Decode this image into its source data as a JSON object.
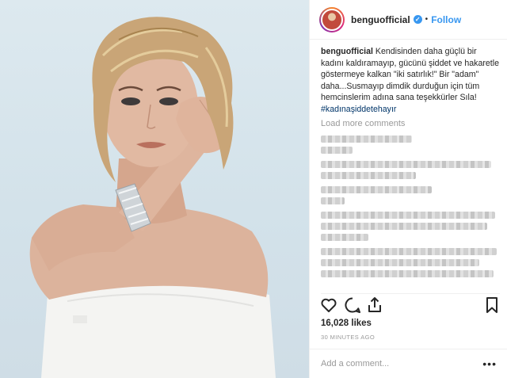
{
  "post": {
    "username": "benguofficial",
    "follow_label": "Follow",
    "dot": "•",
    "verified_glyph": "✓"
  },
  "caption": {
    "username": "benguofficial",
    "text": "Kendisinden daha güçlü bir kadını kaldıramayıp, gücünü şiddet ve hakaretle göstermeye kalkan \"iki satırlık!\" Bir \"adam\" daha...Susmayıp dimdik durduğun için tüm hemcinslerim adına sana teşekkürler Sıla!",
    "hashtag": "#kadınaşiddetehayır"
  },
  "comments": {
    "load_more": "Load more comments"
  },
  "stats": {
    "likes": "16,028 likes",
    "time": "30 MINUTES AGO"
  },
  "composer": {
    "placeholder": "Add a comment...",
    "more": "•••"
  },
  "icons": [
    "heart-icon",
    "comment-icon",
    "share-icon",
    "bookmark-icon"
  ],
  "colors": {
    "link": "#3897f0",
    "text": "#262626",
    "muted": "#999999"
  }
}
